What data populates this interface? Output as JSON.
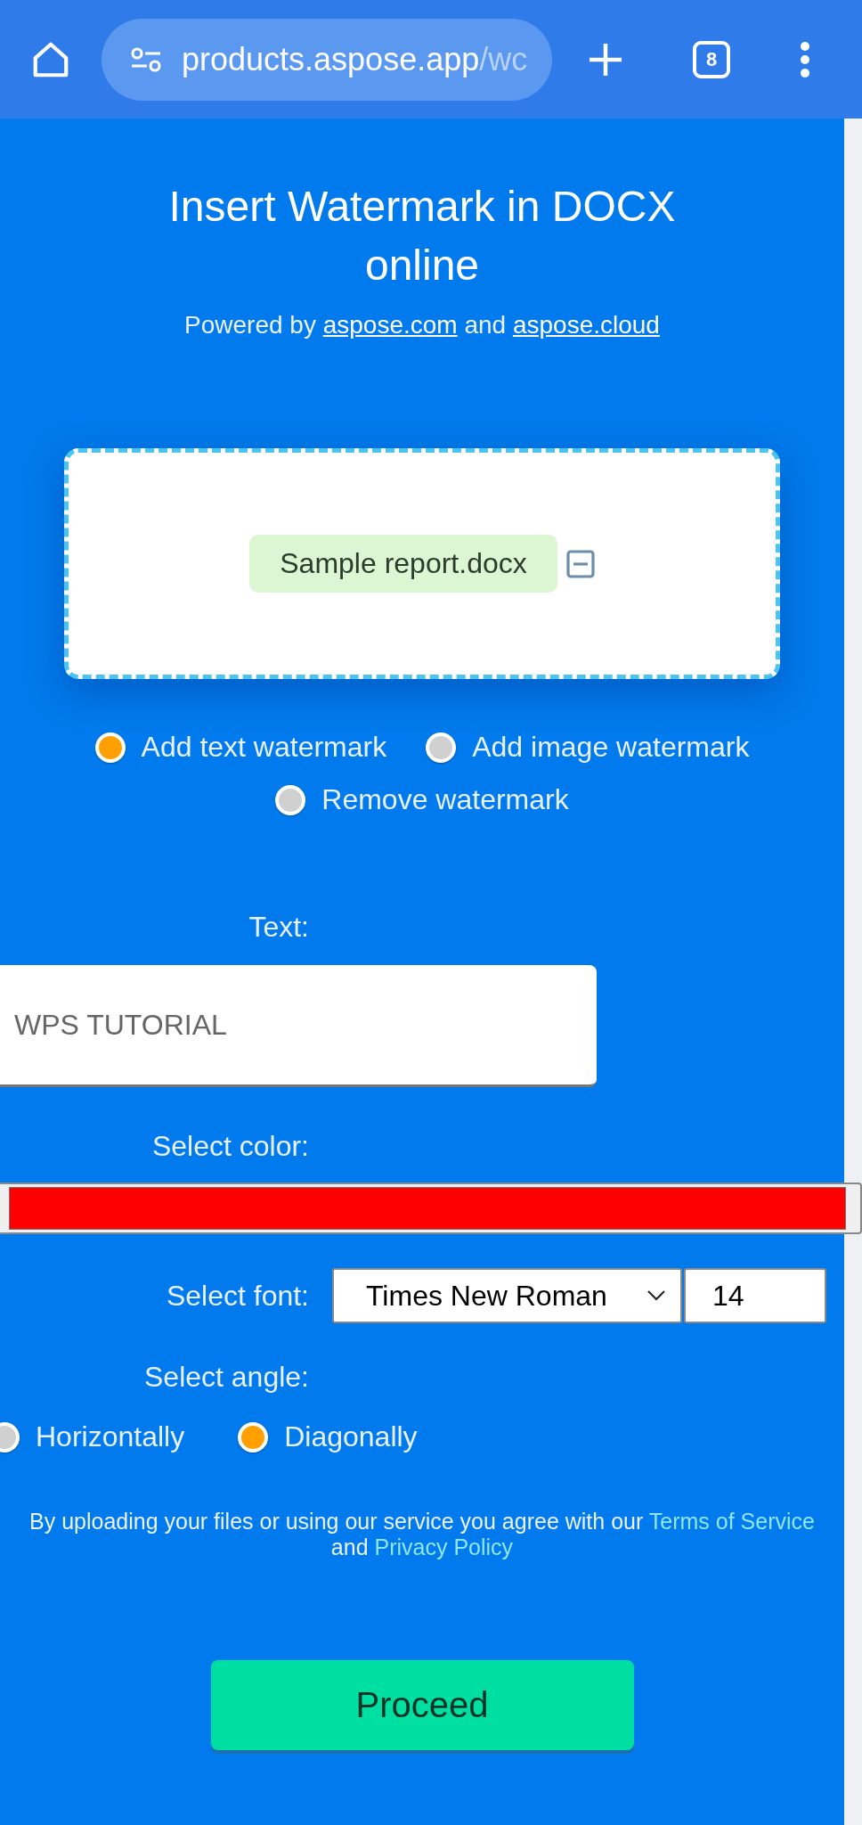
{
  "browser": {
    "url_host": "products.aspose.app",
    "url_path": "/wc",
    "tab_count": "8"
  },
  "header": {
    "title": "Insert Watermark in DOCX online",
    "powered_by": [
      {
        "kind": "text",
        "text": "Powered by"
      },
      {
        "kind": "link",
        "text": "aspose.com"
      },
      {
        "kind": "text",
        "text": "and"
      },
      {
        "kind": "link",
        "text": "aspose.cloud"
      }
    ]
  },
  "upload": {
    "file_name": "Sample report.docx"
  },
  "modes": [
    {
      "label": "Add text watermark",
      "selected": true
    },
    {
      "label": "Add image watermark",
      "selected": false
    },
    {
      "label": "Remove watermark",
      "selected": false
    }
  ],
  "text_field": {
    "label": "Text:",
    "value": "WPS TUTORIAL"
  },
  "color_field": {
    "label": "Select color:",
    "color": "#ff0000"
  },
  "font_field": {
    "label": "Select font:",
    "font": "Times New Roman",
    "size": "14"
  },
  "angle_field": {
    "label": "Select angle:",
    "options": [
      {
        "label": "Horizontally",
        "selected": false
      },
      {
        "label": "Diagonally",
        "selected": true
      }
    ]
  },
  "agreement": [
    {
      "kind": "text",
      "text": "By uploading your files or using our service you agree with our"
    },
    {
      "kind": "link",
      "text": "Terms of Service"
    },
    {
      "kind": "text",
      "text": "and"
    },
    {
      "kind": "link",
      "text": "Privacy Policy"
    }
  ],
  "proceed_button": "Proceed"
}
